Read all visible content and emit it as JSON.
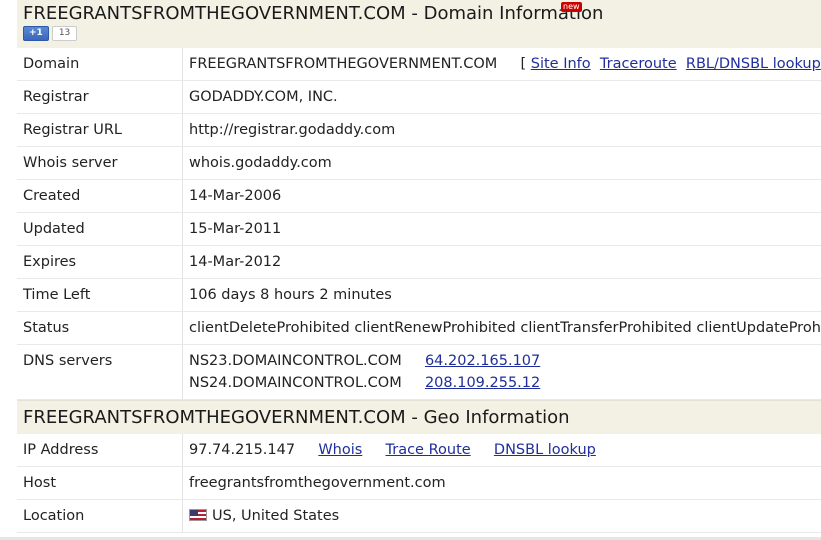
{
  "domain_section": {
    "title": "FREEGRANTSFROMTHEGOVERNMENT.COM - Domain Information",
    "new_badge": "new",
    "gplus_label": "+1",
    "gplus_count": "13"
  },
  "domain_rows": {
    "domain": {
      "label": "Domain",
      "value": "FREEGRANTSFROMTHEGOVERNMENT.COM",
      "bracket_open": "[",
      "links": [
        "Site Info",
        "Traceroute",
        "RBL/DNSBL lookup"
      ],
      "bracket_close": "]"
    },
    "registrar": {
      "label": "Registrar",
      "value": "GODADDY.COM, INC."
    },
    "registrar_url": {
      "label": "Registrar URL",
      "value": "http://registrar.godaddy.com"
    },
    "whois_server": {
      "label": "Whois server",
      "value": "whois.godaddy.com"
    },
    "created": {
      "label": "Created",
      "value": "14-Mar-2006"
    },
    "updated": {
      "label": "Updated",
      "value": "15-Mar-2011"
    },
    "expires": {
      "label": "Expires",
      "value": "14-Mar-2012"
    },
    "time_left": {
      "label": "Time Left",
      "value": "106 days 8 hours 2 minutes"
    },
    "status": {
      "label": "Status",
      "value": "clientDeleteProhibited clientRenewProhibited clientTransferProhibited clientUpdateProhibited"
    },
    "dns": {
      "label": "DNS servers",
      "servers": [
        {
          "host": "NS23.DOMAINCONTROL.COM",
          "ip": "64.202.165.107"
        },
        {
          "host": "NS24.DOMAINCONTROL.COM",
          "ip": "208.109.255.12"
        }
      ]
    }
  },
  "geo_section": {
    "title": "FREEGRANTSFROMTHEGOVERNMENT.COM - Geo Information"
  },
  "geo_rows": {
    "ip": {
      "label": "IP Address",
      "value": "97.74.215.147",
      "links": [
        "Whois",
        "Trace Route",
        "DNSBL lookup"
      ]
    },
    "host": {
      "label": "Host",
      "value": "freegrantsfromthegovernment.com"
    },
    "location": {
      "label": "Location",
      "flag_icon": "us-flag-icon",
      "value": "US, United States"
    }
  }
}
